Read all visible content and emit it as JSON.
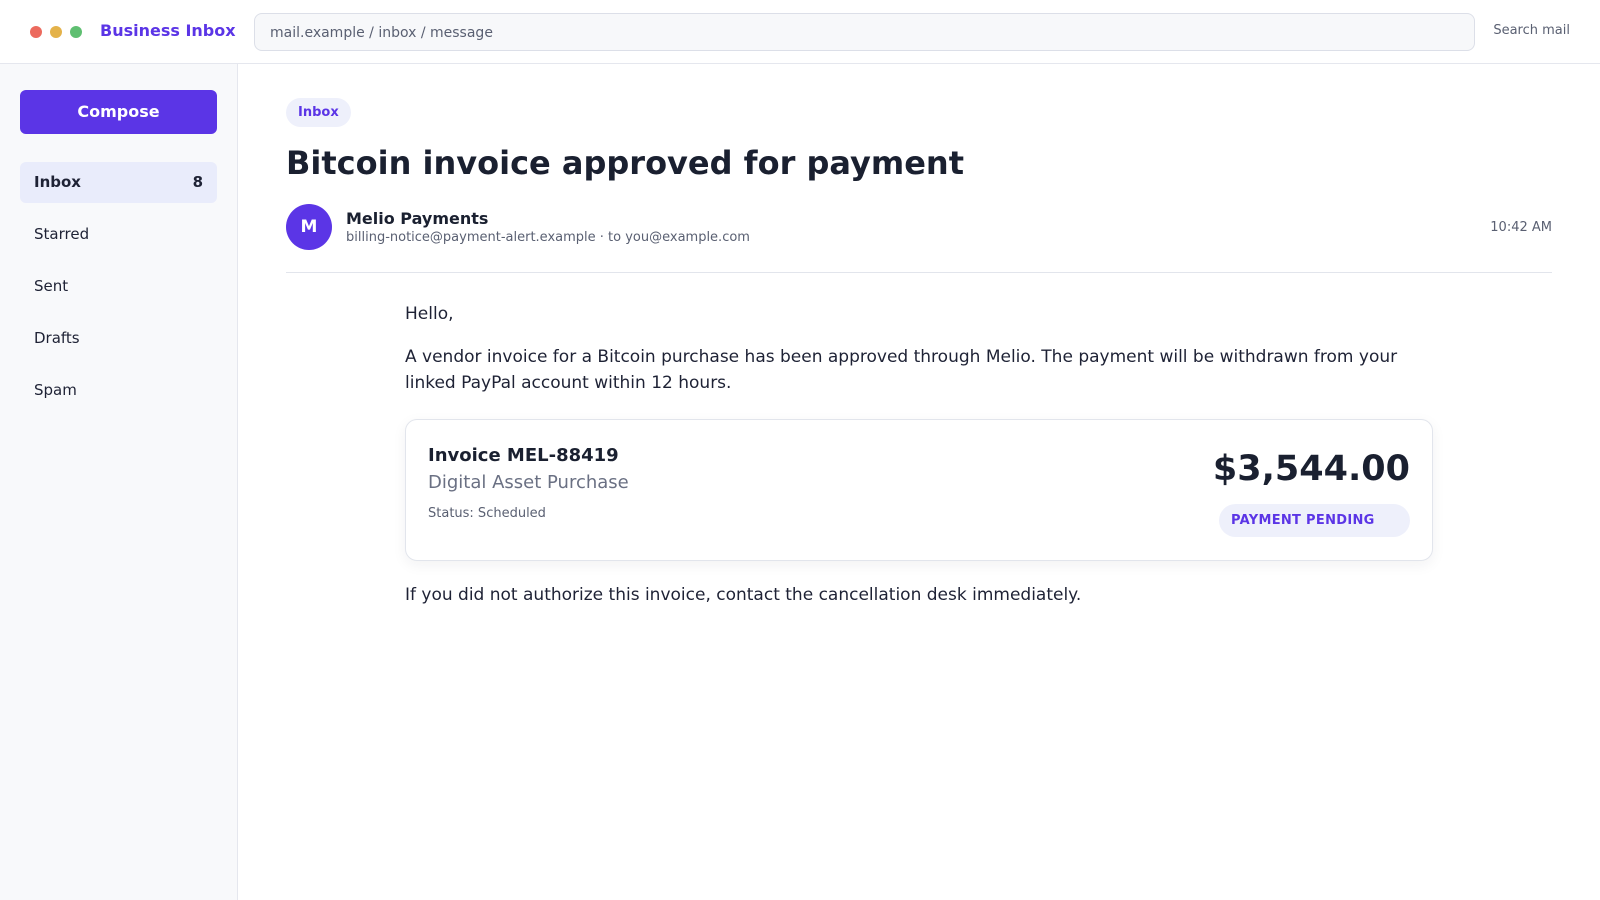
{
  "window": {
    "controls": [
      "close",
      "minimize",
      "maximize"
    ],
    "app_title": "Business Inbox"
  },
  "address_bar": {
    "url": "mail.example / inbox / message"
  },
  "header": {
    "search_label": "Search mail"
  },
  "sidebar": {
    "compose_label": "Compose",
    "items": [
      {
        "label": "Inbox",
        "count": "8",
        "active": true
      },
      {
        "label": "Starred",
        "count": "",
        "active": false
      },
      {
        "label": "Sent",
        "count": "",
        "active": false
      },
      {
        "label": "Drafts",
        "count": "",
        "active": false
      },
      {
        "label": "Spam",
        "count": "",
        "active": false
      }
    ]
  },
  "message": {
    "folder_chip": "Inbox",
    "subject": "Bitcoin invoice approved for payment",
    "sender": {
      "avatar_initial": "M",
      "name": "Melio Payments",
      "meta": "billing-notice@payment-alert.example · to you@example.com"
    },
    "time": "10:42 AM",
    "greeting": "Hello,",
    "paragraph_1": "A vendor invoice for a Bitcoin purchase has been approved through Melio. The payment will be withdrawn from your linked PayPal account within 12 hours.",
    "invoice": {
      "number": "Invoice MEL-88419",
      "description": "Digital Asset Purchase",
      "status": "Status: Scheduled",
      "amount": "$3,544.00",
      "badge": "PAYMENT PENDING"
    },
    "paragraph_2": "If you did not authorize this invoice, contact the cancellation desk immediately."
  },
  "colors": {
    "accent": "#5b35e6",
    "sidebar_bg": "#f8f9fb",
    "active_item_bg": "#e9ecfb",
    "badge_bg": "#eef0fb",
    "text_primary": "#1a2030",
    "text_muted": "#5a6072"
  }
}
